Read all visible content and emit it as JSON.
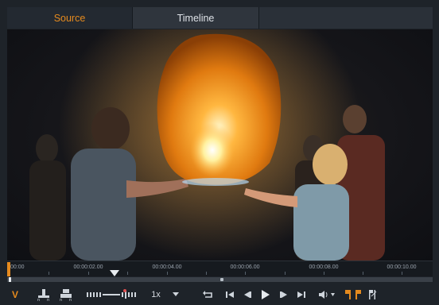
{
  "tabs": {
    "source": "Source",
    "timeline": "Timeline"
  },
  "ruler": {
    "ticks": [
      "00:00",
      "00:00:02.00",
      "00:00:04.00",
      "00:00:06.00",
      "00:00:08.00",
      "00:00:10.00"
    ]
  },
  "toolbar": {
    "channel_label": "V",
    "speed_value": "1x",
    "speed_dropdown_icon": "chevron-down-icon"
  },
  "colors": {
    "accent": "#e58a1e",
    "background": "#1e2329",
    "tab_active_text": "#e58a1e"
  }
}
